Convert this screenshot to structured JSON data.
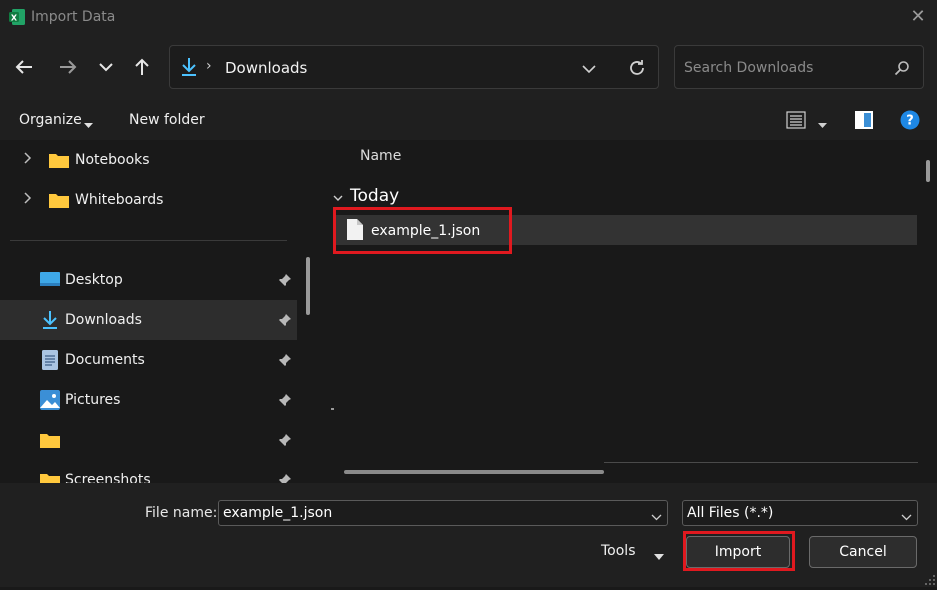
{
  "window": {
    "title": "Import Data"
  },
  "address": {
    "location": "Downloads"
  },
  "search": {
    "placeholder": "Search Downloads"
  },
  "commands": {
    "organize": "Organize",
    "new_folder": "New folder"
  },
  "sidebar": {
    "tree": [
      {
        "label": "Notebooks"
      },
      {
        "label": "Whiteboards"
      }
    ],
    "quick_access": [
      {
        "label": "Desktop"
      },
      {
        "label": "Downloads"
      },
      {
        "label": "Documents"
      },
      {
        "label": "Pictures"
      },
      {
        "label": ""
      },
      {
        "label": "Screenshots"
      }
    ]
  },
  "content": {
    "column_header": "Name",
    "group": "Today",
    "files": [
      {
        "name": "example_1.json"
      }
    ]
  },
  "footer": {
    "file_name_label": "File name:",
    "file_name_value": "example_1.json",
    "file_type": "All Files (*.*)",
    "tools": "Tools",
    "import": "Import",
    "cancel": "Cancel"
  },
  "colors": {
    "accent": "#4cc2ff",
    "highlight": "#e0191f",
    "folder": "#ffc83d"
  }
}
